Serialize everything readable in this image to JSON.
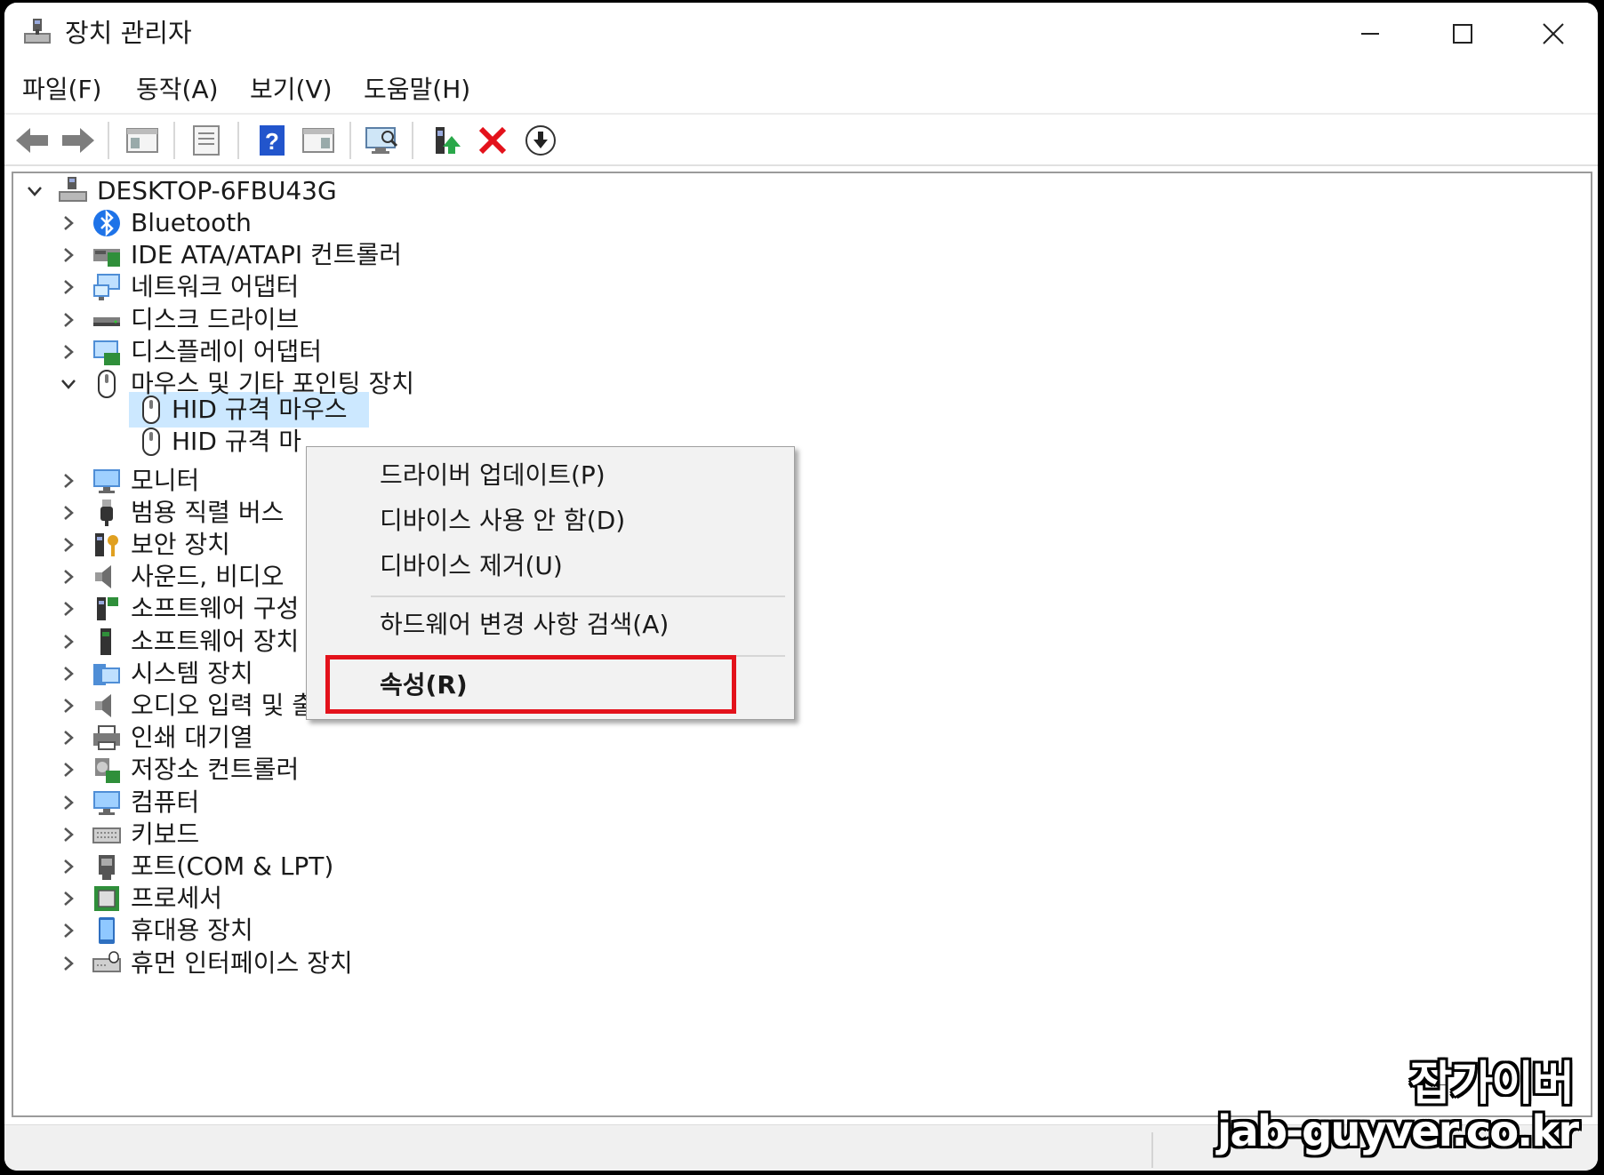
{
  "window": {
    "title": "장치 관리자",
    "controls": {
      "minimize": "minimize-icon",
      "maximize": "maximize-icon",
      "close": "close-icon"
    }
  },
  "menubar": {
    "items": [
      "파일(F)",
      "동작(A)",
      "보기(V)",
      "도움말(H)"
    ]
  },
  "toolbar": {
    "buttons": [
      "back-icon",
      "forward-icon",
      "show-hide-console-tree-icon",
      "properties-icon",
      "help-icon",
      "action-pane-icon",
      "scan-hardware-icon",
      "update-driver-icon",
      "uninstall-icon",
      "enable-device-icon"
    ]
  },
  "tree": {
    "root": "DESKTOP-6FBU43G",
    "categories": [
      {
        "label": "Bluetooth",
        "icon": "bluetooth-icon",
        "expanded": false
      },
      {
        "label": "IDE ATA/ATAPI 컨트롤러",
        "icon": "ide-controller-icon",
        "expanded": false
      },
      {
        "label": "네트워크 어댑터",
        "icon": "network-adapter-icon",
        "expanded": false
      },
      {
        "label": "디스크 드라이브",
        "icon": "disk-drive-icon",
        "expanded": false
      },
      {
        "label": "디스플레이 어댑터",
        "icon": "display-adapter-icon",
        "expanded": false
      },
      {
        "label": "마우스 및 기타 포인팅 장치",
        "icon": "mouse-icon",
        "expanded": true
      },
      {
        "label": "모니터",
        "icon": "monitor-icon",
        "expanded": false
      },
      {
        "label": "범용 직렬 버스",
        "icon": "usb-icon",
        "expanded": false
      },
      {
        "label": "보안 장치",
        "icon": "security-device-icon",
        "expanded": false
      },
      {
        "label": "사운드, 비디오",
        "icon": "sound-icon",
        "expanded": false
      },
      {
        "label": "소프트웨어 구성",
        "icon": "software-component-icon",
        "expanded": false
      },
      {
        "label": "소프트웨어 장치",
        "icon": "software-device-icon",
        "expanded": false
      },
      {
        "label": "시스템 장치",
        "icon": "system-device-icon",
        "expanded": false
      },
      {
        "label": "오디오 입력 및 출력",
        "icon": "audio-io-icon",
        "expanded": false
      },
      {
        "label": "인쇄 대기열",
        "icon": "print-queue-icon",
        "expanded": false
      },
      {
        "label": "저장소 컨트롤러",
        "icon": "storage-controller-icon",
        "expanded": false
      },
      {
        "label": "컴퓨터",
        "icon": "computer-icon",
        "expanded": false
      },
      {
        "label": "키보드",
        "icon": "keyboard-icon",
        "expanded": false
      },
      {
        "label": "포트(COM & LPT)",
        "icon": "port-icon",
        "expanded": false
      },
      {
        "label": "프로세서",
        "icon": "processor-icon",
        "expanded": false
      },
      {
        "label": "휴대용 장치",
        "icon": "portable-device-icon",
        "expanded": false
      },
      {
        "label": "휴먼 인터페이스 장치",
        "icon": "hid-icon",
        "expanded": false
      }
    ],
    "mouse_children": [
      "HID 규격 마우스",
      "HID 규격 마"
    ]
  },
  "context_menu": {
    "items": [
      "드라이버 업데이트(P)",
      "디바이스 사용 안 함(D)",
      "디바이스 제거(U)",
      "하드웨어 변경 사항 검색(A)",
      "속성(R)"
    ],
    "highlighted": "속성(R)",
    "highlight_color": "#e3121b"
  },
  "watermark": {
    "line1": "잡가이버",
    "line2": "jab-guyver.co.kr"
  },
  "colors": {
    "selection": "#cce8ff",
    "delete_red": "#e3121b",
    "help_blue": "#2255cc"
  }
}
